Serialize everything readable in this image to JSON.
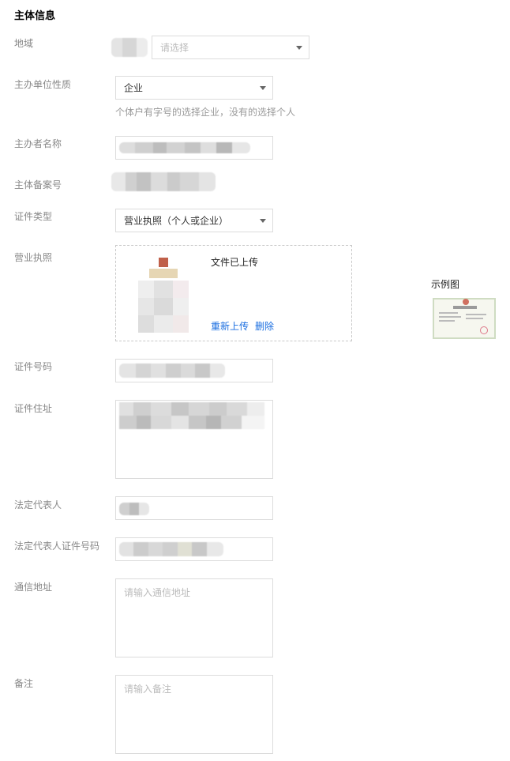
{
  "section": {
    "title": "主体信息"
  },
  "fields": {
    "region": {
      "label": "地域",
      "placeholder": "请选择"
    },
    "org_type": {
      "label": "主办单位性质",
      "value": "企业",
      "hint": "个体户有字号的选择企业，没有的选择个人"
    },
    "sponsor_name": {
      "label": "主办者名称"
    },
    "subject_record": {
      "label": "主体备案号"
    },
    "cert_type": {
      "label": "证件类型",
      "value": "营业执照（个人或企业）"
    },
    "license": {
      "label": "营业执照",
      "status": "文件已上传",
      "reupload": "重新上传",
      "delete": "删除",
      "example_label": "示例图"
    },
    "cert_number": {
      "label": "证件号码"
    },
    "cert_address": {
      "label": "证件住址"
    },
    "legal_rep": {
      "label": "法定代表人"
    },
    "legal_rep_id": {
      "label": "法定代表人证件号码"
    },
    "mail_address": {
      "label": "通信地址",
      "placeholder": "请输入通信地址"
    },
    "remark": {
      "label": "备注",
      "placeholder": "请输入备注"
    }
  }
}
